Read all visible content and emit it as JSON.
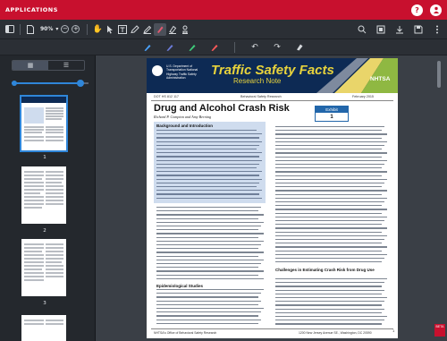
{
  "app": {
    "title": "APPLICATIONS",
    "accent_color": "#c8102e",
    "help_icon": "?",
    "user_icon": "person-icon"
  },
  "toolbar": {
    "zoom_value": "90%",
    "zoom_minus": "−",
    "zoom_plus": "+",
    "icons_left": [
      "sidebar-toggle-icon",
      "file-icon"
    ],
    "icons_tools": [
      "hand-icon",
      "select-icon",
      "text-icon",
      "comment-icon",
      "pen-icon",
      "highlight-icon",
      "eraser-icon",
      "stamp-icon"
    ],
    "icons_right": [
      "search-icon",
      "fullscreen-icon",
      "download-icon",
      "save-icon",
      "more-icon"
    ]
  },
  "toolbar2": {
    "icons": [
      "pen-blue-icon",
      "pen-dark-icon",
      "pen-green-icon",
      "pen-red-icon",
      "undo-icon",
      "redo-icon",
      "eraser-icon"
    ]
  },
  "sidebar": {
    "view_toggle": [
      "grid-icon",
      "list-icon"
    ],
    "slider_value": 0.9,
    "thumbnails": [
      {
        "label": "1"
      },
      {
        "label": "2"
      },
      {
        "label": "3"
      }
    ]
  },
  "document": {
    "agency": "U.S. Department of Transportation National Highway Traffic Safety Administration",
    "brand_title": "Traffic Safety Facts",
    "brand_subtitle": "Research Note",
    "nhtsa_logo": "NHTSA",
    "doc_number": "DOT HS 812 117",
    "category": "Behavioral Safety Research",
    "date": "February 2015",
    "title": "Drug and Alcohol Crash Risk",
    "authors": "Richard P. Compton and Amy Berning",
    "exhibit_label": "Exhibit",
    "exhibit_number": "1",
    "section_background": "Background and Introduction",
    "section_epidemiology": "Epidemiological Studies",
    "section_challenges": "Challenges in Estimating Crash Risk from Drug Use",
    "footer_left": "NHTSA's Office of Behavioral Safety Research",
    "footer_right": "1200 New Jersey Avenue SE., Washington, DC 20590",
    "page_number": "1"
  },
  "corner_badge": "BETA"
}
